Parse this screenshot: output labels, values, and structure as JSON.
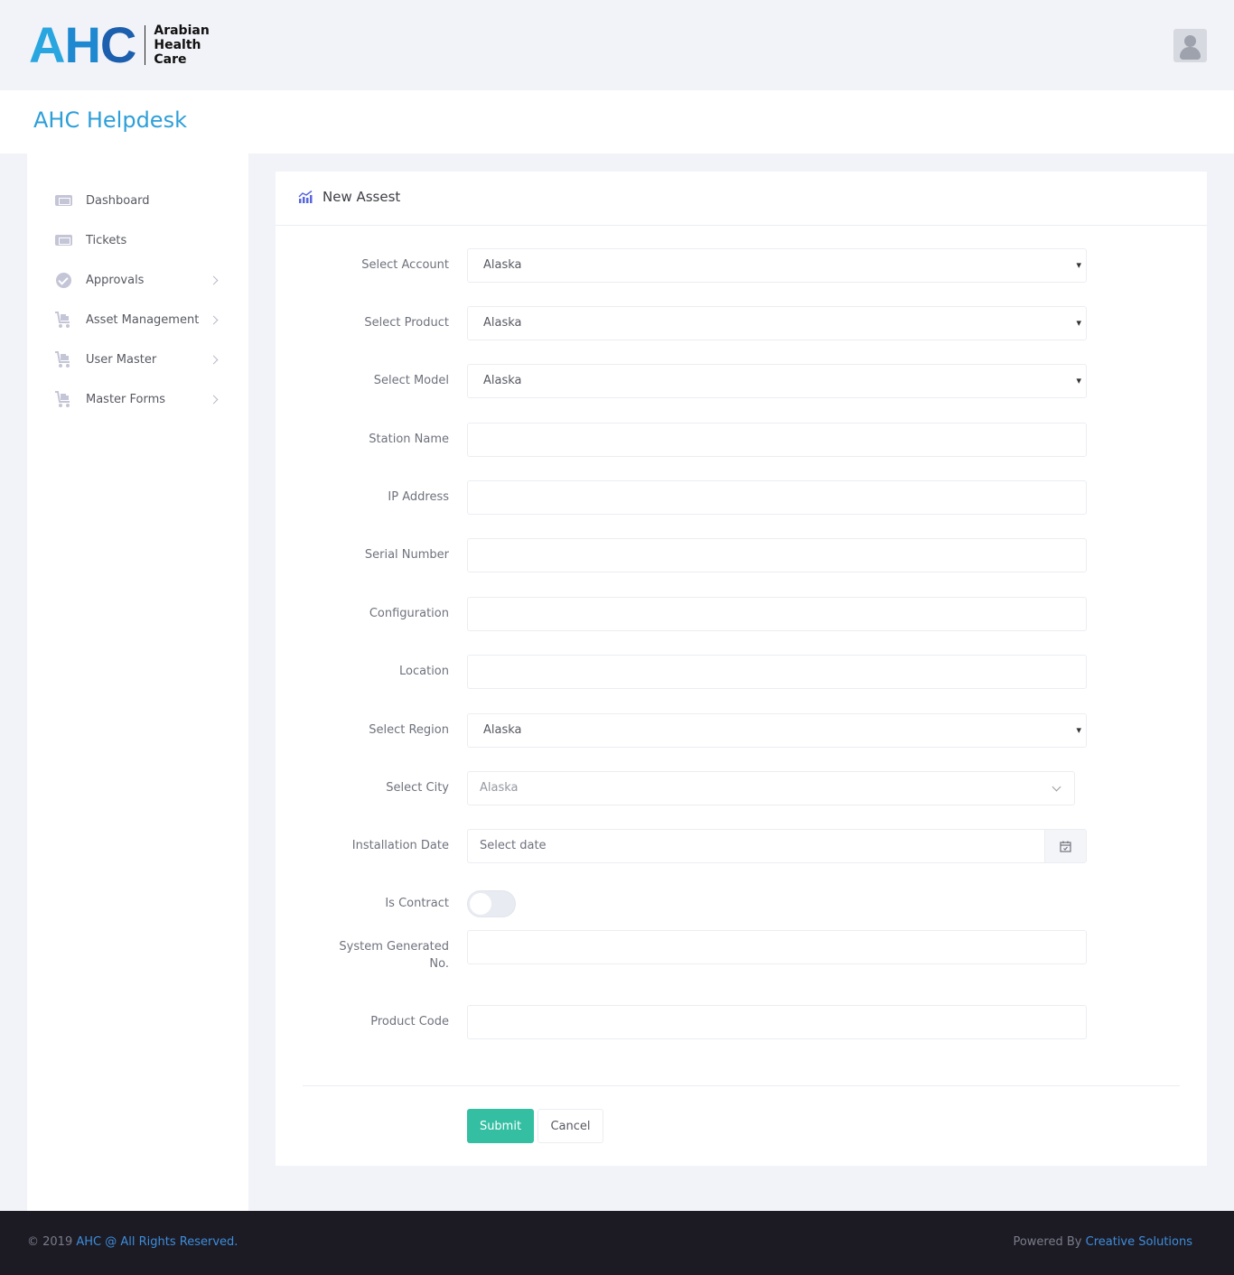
{
  "header": {
    "logo_mark": "AHC",
    "logo_text_line1": "Arabian",
    "logo_text_line2": "Health",
    "logo_text_line3": "Care"
  },
  "page_title": "AHC Helpdesk",
  "sidebar": {
    "items": [
      {
        "label": "Dashboard",
        "icon": "ticket-icon",
        "has_submenu": false
      },
      {
        "label": "Tickets",
        "icon": "ticket-icon",
        "has_submenu": false
      },
      {
        "label": "Approvals",
        "icon": "check-circle-icon",
        "has_submenu": true
      },
      {
        "label": "Asset Management",
        "icon": "cart-icon",
        "has_submenu": true
      },
      {
        "label": "User Master",
        "icon": "cart-icon",
        "has_submenu": true
      },
      {
        "label": "Master Forms",
        "icon": "cart-icon",
        "has_submenu": true
      }
    ]
  },
  "form": {
    "title": "New Assest",
    "fields": {
      "account": {
        "label": "Select Account",
        "value": "Alaska"
      },
      "product": {
        "label": "Select Product",
        "value": "Alaska"
      },
      "model": {
        "label": "Select Model",
        "value": "Alaska"
      },
      "station": {
        "label": "Station Name",
        "value": ""
      },
      "ip": {
        "label": "IP Address",
        "value": ""
      },
      "serial": {
        "label": "Serial Number",
        "value": ""
      },
      "config": {
        "label": "Configuration",
        "value": ""
      },
      "location": {
        "label": "Location",
        "value": ""
      },
      "region": {
        "label": "Select Region",
        "value": "Alaska"
      },
      "city": {
        "label": "Select City",
        "value": "Alaska"
      },
      "install_date": {
        "label": "Installation Date",
        "placeholder": "Select date"
      },
      "is_contract": {
        "label": "Is Contract",
        "checked": false
      },
      "system_no": {
        "label_line1": "System Generated",
        "label_line2": "No.",
        "value": ""
      },
      "product_code": {
        "label": "Product Code",
        "value": ""
      }
    },
    "submit_label": "Submit",
    "cancel_label": "Cancel"
  },
  "footer": {
    "left_prefix": "© 2019 ",
    "left_link": "AHC @ All Rights Reserved.",
    "right_prefix": "Powered By ",
    "right_link": "Creative Solutions"
  },
  "colors": {
    "accent": "#2d9fd9",
    "submit": "#34bfa3",
    "footer_bg": "#1c1b24"
  }
}
